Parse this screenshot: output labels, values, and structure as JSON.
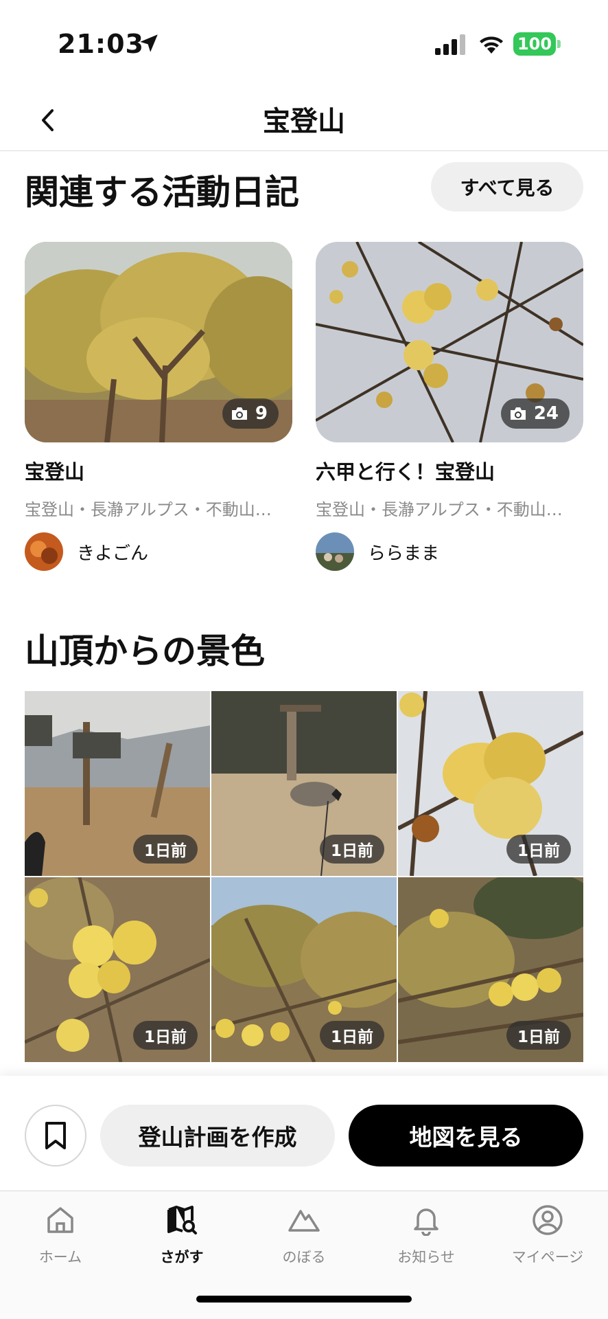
{
  "status_bar": {
    "time": "21:03",
    "battery": "100",
    "icons": [
      "location-arrow-icon",
      "cellular-signal-icon",
      "wifi-icon",
      "battery-icon"
    ]
  },
  "header": {
    "title": "宝登山",
    "back_icon": "chevron-left-icon"
  },
  "diaries": {
    "title": "関連する活動日記",
    "see_all_label": "すべて見る",
    "cards": [
      {
        "title": "宝登山",
        "tags": "宝登山・長瀞アルプス・不動山…",
        "user": "きよごん",
        "photo_count": "9",
        "camera_icon": "camera-icon"
      },
      {
        "title": "六甲と行く！宝登山",
        "tags": "宝登山・長瀞アルプス・不動山…",
        "user": "ららまま",
        "photo_count": "24",
        "camera_icon": "camera-icon"
      }
    ]
  },
  "summit": {
    "title": "山頂からの景色",
    "photos": [
      {
        "time": "1日前"
      },
      {
        "time": "1日前"
      },
      {
        "time": "1日前"
      },
      {
        "time": "1日前"
      },
      {
        "time": "1日前"
      },
      {
        "time": "1日前"
      }
    ]
  },
  "actions": {
    "bookmark_icon": "bookmark-icon",
    "plan_label": "登山計画を作成",
    "map_label": "地図を見る"
  },
  "tabs": [
    {
      "label": "ホーム",
      "icon": "home-icon",
      "active": false
    },
    {
      "label": "さがす",
      "icon": "map-search-icon",
      "active": true
    },
    {
      "label": "のぼる",
      "icon": "mountain-icon",
      "active": false
    },
    {
      "label": "お知らせ",
      "icon": "bell-icon",
      "active": false
    },
    {
      "label": "マイページ",
      "icon": "user-circle-icon",
      "active": false
    }
  ],
  "colors": {
    "battery": "#34c759",
    "accent": "#000000",
    "secondary_button": "#efefef",
    "muted_text": "#8a8a8a"
  }
}
